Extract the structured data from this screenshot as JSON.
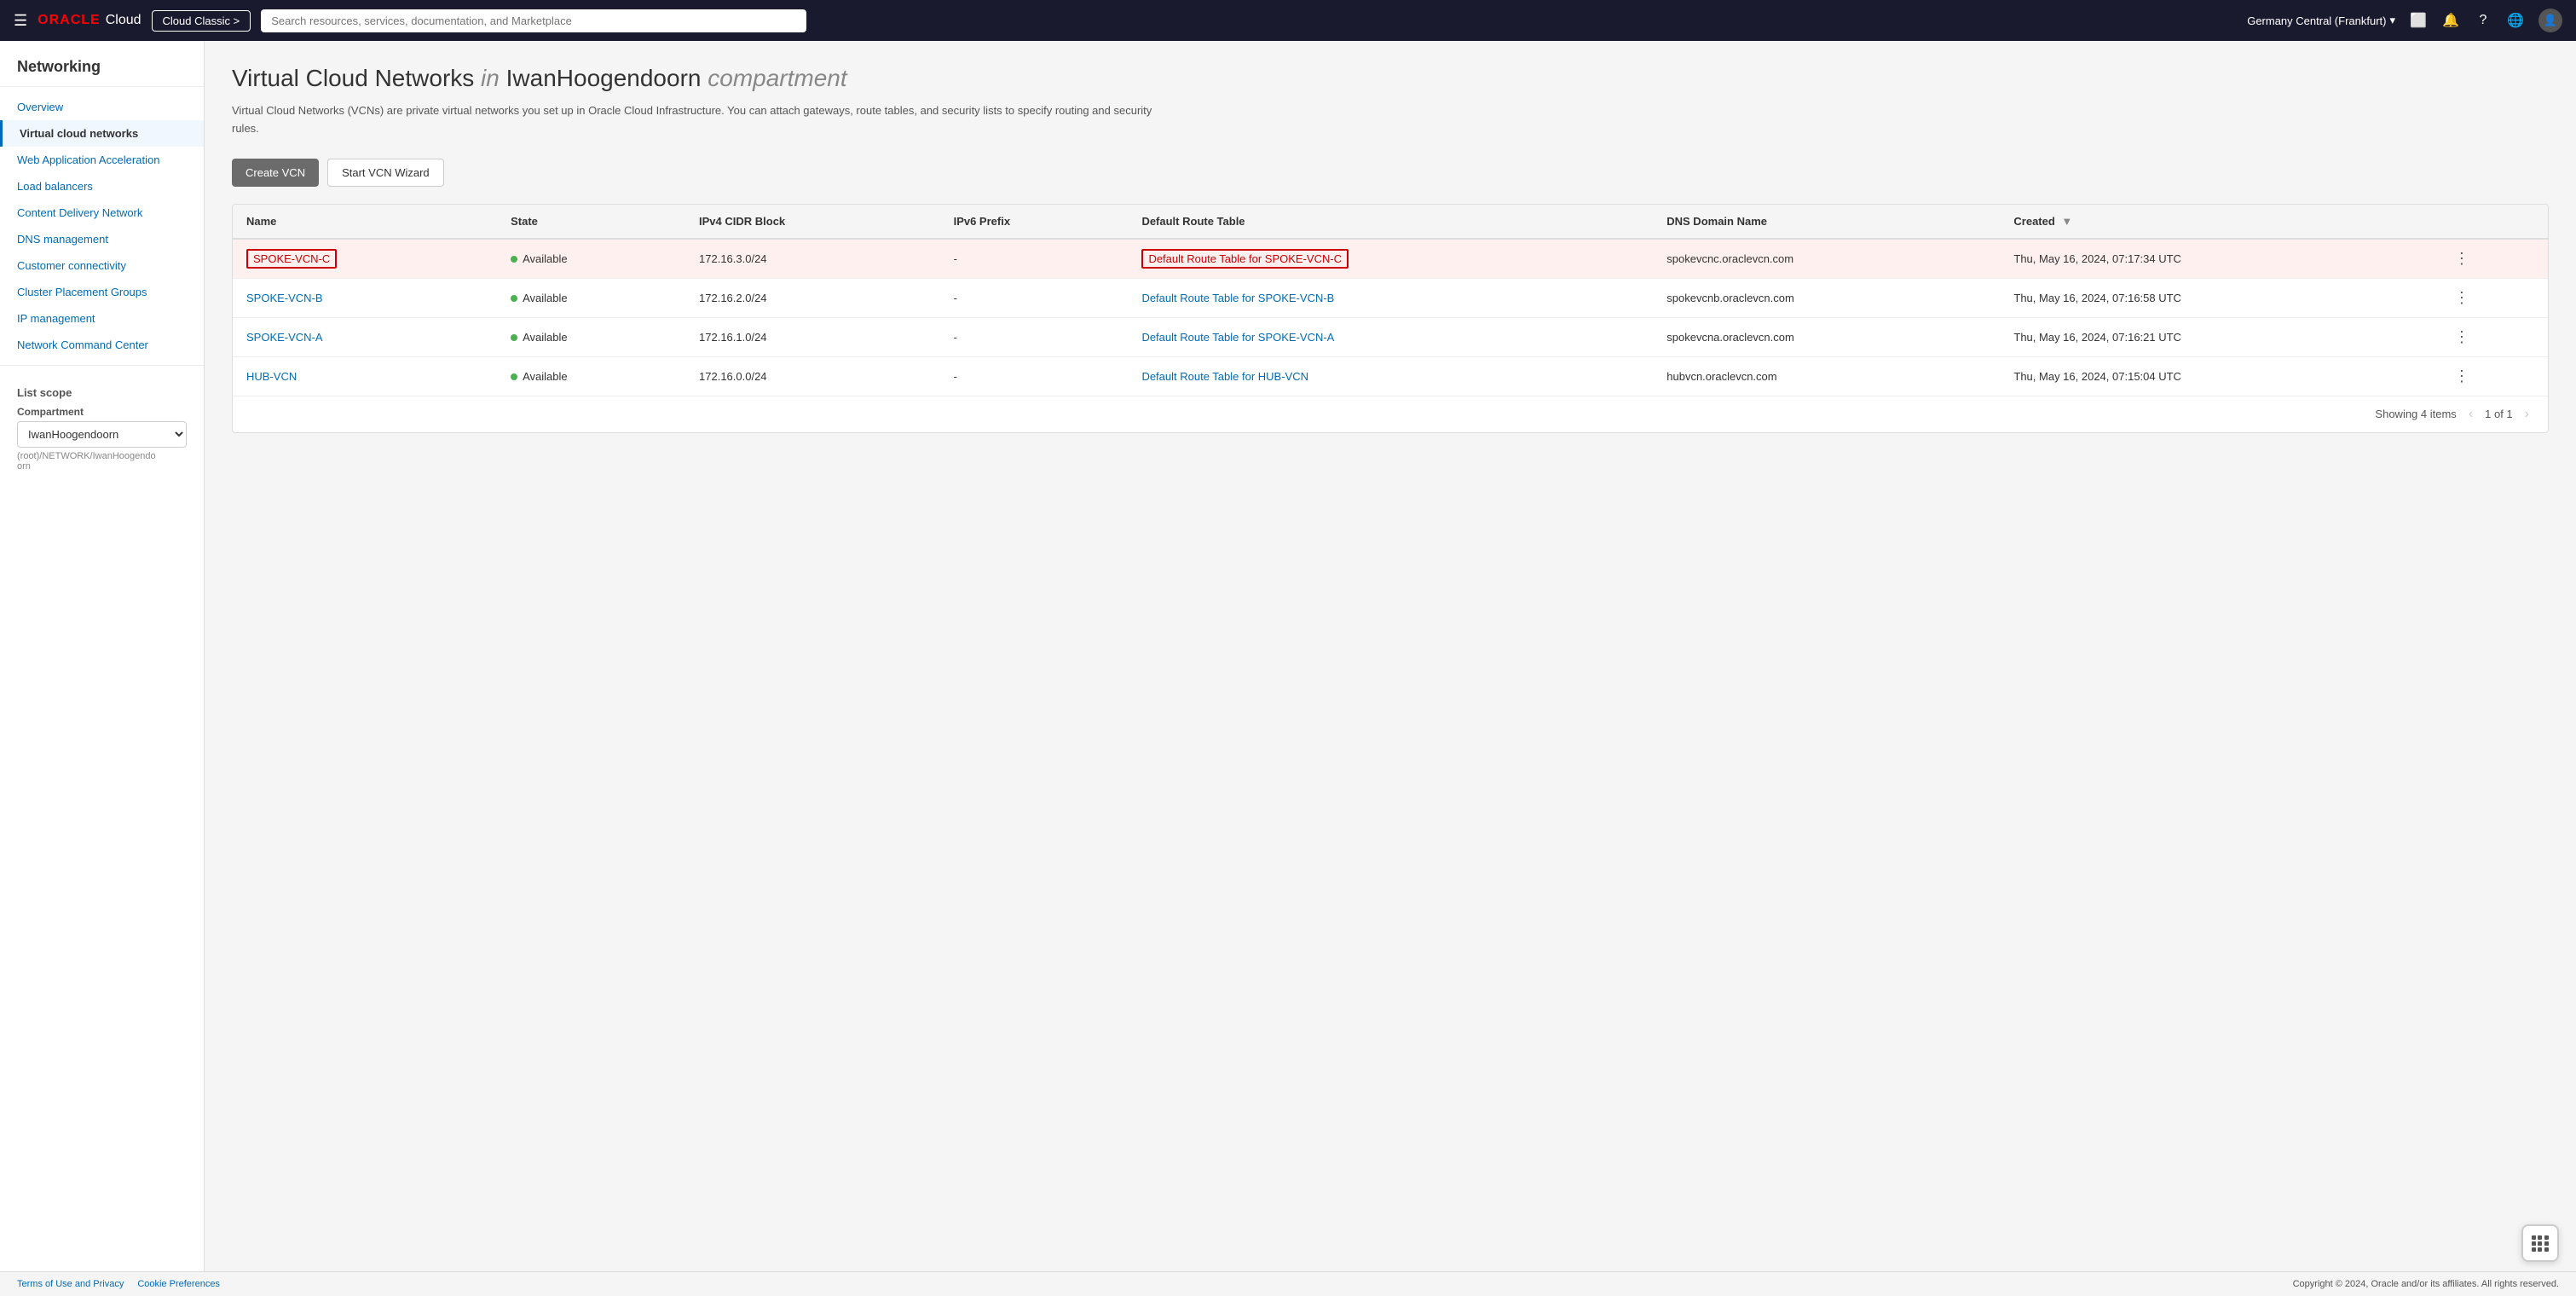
{
  "topnav": {
    "oracle_text": "ORACLE",
    "cloud_text": "Cloud",
    "cloud_classic_label": "Cloud Classic >",
    "search_placeholder": "Search resources, services, documentation, and Marketplace",
    "region": "Germany Central (Frankfurt)",
    "icons": {
      "monitor": "⬜",
      "bell": "🔔",
      "help": "?",
      "globe": "🌐"
    }
  },
  "sidebar": {
    "title": "Networking",
    "items": [
      {
        "id": "overview",
        "label": "Overview",
        "active": false
      },
      {
        "id": "virtual-cloud-networks",
        "label": "Virtual cloud networks",
        "active": true
      },
      {
        "id": "web-application-acceleration",
        "label": "Web Application Acceleration",
        "active": false
      },
      {
        "id": "load-balancers",
        "label": "Load balancers",
        "active": false
      },
      {
        "id": "content-delivery-network",
        "label": "Content Delivery Network",
        "active": false
      },
      {
        "id": "dns-management",
        "label": "DNS management",
        "active": false
      },
      {
        "id": "customer-connectivity",
        "label": "Customer connectivity",
        "active": false
      },
      {
        "id": "cluster-placement-groups",
        "label": "Cluster Placement Groups",
        "active": false
      },
      {
        "id": "ip-management",
        "label": "IP management",
        "active": false
      },
      {
        "id": "network-command-center",
        "label": "Network Command Center",
        "active": false
      }
    ],
    "list_scope": {
      "title": "List scope",
      "compartment_label": "Compartment",
      "compartment_value": "IwanHoogendoorn",
      "compartment_path": "(root)/NETWORK/IwanHoogendo\norn"
    }
  },
  "main": {
    "page_title": "Virtual Cloud Networks",
    "page_title_in": "in",
    "page_title_compartment": "IwanHoogendoorn",
    "page_title_italic": "compartment",
    "page_description": "Virtual Cloud Networks (VCNs) are private virtual networks you set up in Oracle Cloud Infrastructure. You can attach gateways, route tables, and security lists to specify routing and security rules.",
    "create_vcn_label": "Create VCN",
    "start_wizard_label": "Start VCN Wizard",
    "table": {
      "columns": [
        {
          "id": "name",
          "label": "Name",
          "sortable": false
        },
        {
          "id": "state",
          "label": "State",
          "sortable": false
        },
        {
          "id": "ipv4",
          "label": "IPv4 CIDR Block",
          "sortable": false
        },
        {
          "id": "ipv6",
          "label": "IPv6 Prefix",
          "sortable": false
        },
        {
          "id": "route_table",
          "label": "Default Route Table",
          "sortable": false
        },
        {
          "id": "dns",
          "label": "DNS Domain Name",
          "sortable": false
        },
        {
          "id": "created",
          "label": "Created",
          "sortable": true
        }
      ],
      "rows": [
        {
          "id": "spoke-vcn-c",
          "name": "SPOKE-VCN-C",
          "state": "Available",
          "ipv4": "172.16.3.0/24",
          "ipv6": "-",
          "route_table": "Default Route Table for SPOKE-VCN-C",
          "dns": "spokevcnc.oraclevcn.com",
          "created": "Thu, May 16, 2024, 07:17:34 UTC",
          "selected": true
        },
        {
          "id": "spoke-vcn-b",
          "name": "SPOKE-VCN-B",
          "state": "Available",
          "ipv4": "172.16.2.0/24",
          "ipv6": "-",
          "route_table": "Default Route Table for SPOKE-VCN-B",
          "dns": "spokevcnb.oraclevcn.com",
          "created": "Thu, May 16, 2024, 07:16:58 UTC",
          "selected": false
        },
        {
          "id": "spoke-vcn-a",
          "name": "SPOKE-VCN-A",
          "state": "Available",
          "ipv4": "172.16.1.0/24",
          "ipv6": "-",
          "route_table": "Default Route Table for SPOKE-VCN-A",
          "dns": "spokevcna.oraclevcn.com",
          "created": "Thu, May 16, 2024, 07:16:21 UTC",
          "selected": false
        },
        {
          "id": "hub-vcn",
          "name": "HUB-VCN",
          "state": "Available",
          "ipv4": "172.16.0.0/24",
          "ipv6": "-",
          "route_table": "Default Route Table for HUB-VCN",
          "dns": "hubvcn.oraclevcn.com",
          "created": "Thu, May 16, 2024, 07:15:04 UTC",
          "selected": false
        }
      ],
      "footer": {
        "showing_text": "Showing 4 items",
        "page_info": "1 of 1"
      }
    }
  },
  "footer": {
    "terms_label": "Terms of Use and Privacy",
    "cookies_label": "Cookie Preferences",
    "copyright": "Copyright © 2024, Oracle and/or its affiliates. All rights reserved."
  }
}
